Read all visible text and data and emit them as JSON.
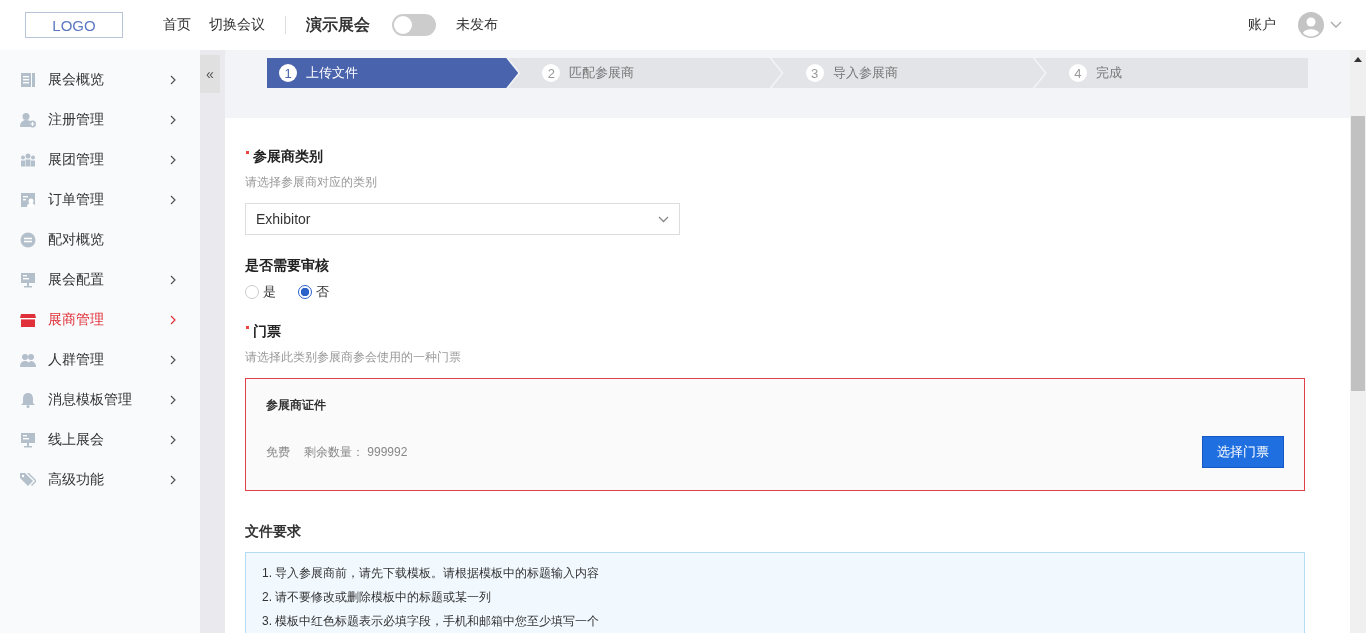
{
  "header": {
    "logo": "LOGO",
    "nav": [
      "首页",
      "切换会议"
    ],
    "event_title": "演示展会",
    "publish_toggle": {
      "on": false
    },
    "publish_status": "未发布",
    "account": "账户"
  },
  "sidebar": {
    "collapse_button": "«",
    "items": [
      {
        "label": "展会概览",
        "selected": false,
        "has_submenu": true
      },
      {
        "label": "注册管理",
        "selected": false,
        "has_submenu": true
      },
      {
        "label": "展团管理",
        "selected": false,
        "has_submenu": true
      },
      {
        "label": "订单管理",
        "selected": false,
        "has_submenu": true
      },
      {
        "label": "配对概览",
        "selected": false,
        "has_submenu": false
      },
      {
        "label": "展会配置",
        "selected": false,
        "has_submenu": true
      },
      {
        "label": "展商管理",
        "selected": true,
        "has_submenu": true
      },
      {
        "label": "人群管理",
        "selected": false,
        "has_submenu": true
      },
      {
        "label": "消息模板管理",
        "selected": false,
        "has_submenu": true
      },
      {
        "label": "线上展会",
        "selected": false,
        "has_submenu": true
      },
      {
        "label": "高级功能",
        "selected": false,
        "has_submenu": true
      }
    ]
  },
  "steps": [
    {
      "number": "1",
      "label": "上传文件",
      "selected": true
    },
    {
      "number": "2",
      "label": "匹配参展商",
      "selected": false
    },
    {
      "number": "3",
      "label": "导入参展商",
      "selected": false
    },
    {
      "number": "4",
      "label": "完成",
      "selected": false
    }
  ],
  "form": {
    "category": {
      "label": "参展商类别",
      "required": true,
      "hint": "请选择参展商对应的类别",
      "value": "Exhibitor"
    },
    "review": {
      "label": "是否需要审核",
      "options": [
        {
          "label": "是",
          "selected": false
        },
        {
          "label": "否",
          "selected": true
        }
      ]
    },
    "ticket": {
      "label": "门票",
      "required": true,
      "hint": "请选择此类别参展商参会使用的一种门票",
      "card": {
        "title": "参展商证件",
        "price": "免费",
        "remaining": "剩余数量： 999992",
        "button": "选择门票"
      }
    },
    "requirements": {
      "title": "文件要求",
      "lines": [
        "1. 导入参展商前，请先下载模板。请根据模板中的标题输入内容",
        "2. 请不要修改或删除模板中的标题或某一列",
        "3. 模板中红色标题表示必填字段，手机和邮箱中您至少填写一个"
      ]
    }
  }
}
